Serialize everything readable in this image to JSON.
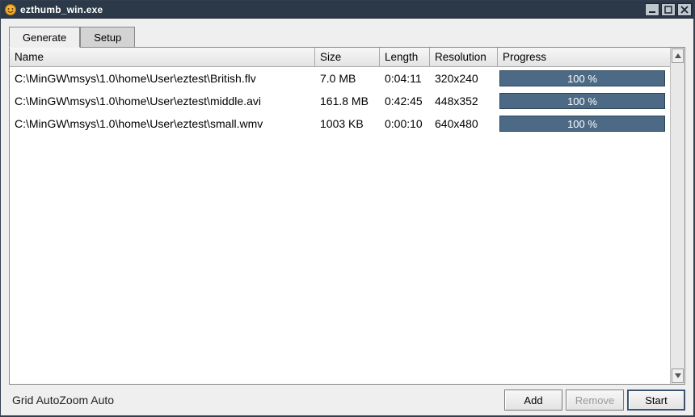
{
  "window": {
    "title": "ezthumb_win.exe"
  },
  "tabs": [
    {
      "label": "Generate",
      "active": true
    },
    {
      "label": "Setup",
      "active": false
    }
  ],
  "columns": {
    "name": "Name",
    "size": "Size",
    "length": "Length",
    "resolution": "Resolution",
    "progress": "Progress"
  },
  "rows": [
    {
      "name": "C:\\MinGW\\msys\\1.0\\home\\User\\eztest\\British.flv",
      "size": "7.0 MB",
      "length": "0:04:11",
      "resolution": "320x240",
      "progress": "100 %"
    },
    {
      "name": "C:\\MinGW\\msys\\1.0\\home\\User\\eztest\\middle.avi",
      "size": "161.8 MB",
      "length": "0:42:45",
      "resolution": "448x352",
      "progress": "100 %"
    },
    {
      "name": "C:\\MinGW\\msys\\1.0\\home\\User\\eztest\\small.wmv",
      "size": "1003 KB",
      "length": "0:00:10",
      "resolution": "640x480",
      "progress": "100 %"
    }
  ],
  "status": {
    "grid": "Grid Auto",
    "zoom": "Zoom Auto"
  },
  "buttons": {
    "add": "Add",
    "remove": "Remove",
    "start": "Start"
  }
}
